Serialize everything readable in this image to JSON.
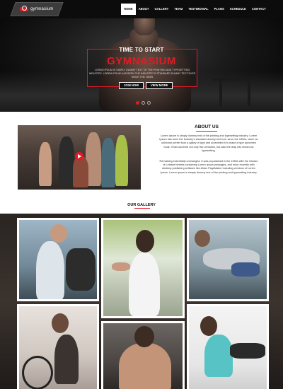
{
  "header": {
    "logo_text": "gymnasium",
    "nav": [
      "HOME",
      "ABOUT",
      "GALLERY",
      "TEAM",
      "TESTIMONIAL",
      "PLANS",
      "SCHEDULE",
      "CONTACT"
    ],
    "active_nav": "HOME"
  },
  "hero": {
    "subtitle": "TIME TO START",
    "title": "GYMNASIUM",
    "description": "LOREM IPSUM IS SIMPLY DUMMY TEXT OF THE PRINTING AND TYPESETTING INDUSTRY. LOREM IPSUM HAS BEEN THE INDUSTRY'S STANDARD DUMMY TEXT EVER SINCE THE 1500S",
    "join_button": "JOIN NOW",
    "menu_button": "VIEW MORE",
    "slides": 3,
    "active_slide": 1
  },
  "about": {
    "title": "ABOUT US",
    "paragraph1": "Lorem Ipsum is simply dummy text of the printing and typesetting industry. Lorem Ipsum has been the industry's standard dummy text ever since the 1500s, when an unknown printer took a galley of type and scrambled it to make a type specimen book. It has survived not only five centuries, but also the leap into electronic typesetting.",
    "paragraph2": "Remaining essentially unchanged. It was popularised in the 1960s with the release of Letraset sheets containing Lorem Ipsum passages, and more recently with desktop publishing software like Aldus PageMaker including versions of Lorem Ipsum. Lorem Ipsum is simply dummy text of the printing and typesetting industry."
  },
  "gallery": {
    "title": "OUR GALLERY"
  },
  "colors": {
    "accent": "#e01b24",
    "dark": "#0c0c0c"
  }
}
